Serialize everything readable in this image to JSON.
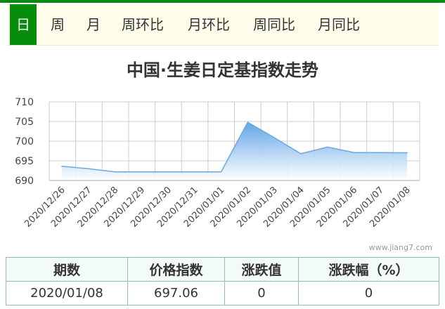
{
  "tabs": [
    "日",
    "周",
    "月",
    "周环比",
    "月环比",
    "周同比",
    "月同比"
  ],
  "active_tab": 0,
  "chart_title": "中国·生姜日定基指数走势",
  "watermark": "www.jiang7.com",
  "colors": {
    "brand": "#078d0c",
    "line": "#6aa9e0",
    "grid": "#cccccc"
  },
  "chart_data": {
    "type": "area",
    "title": "中国·生姜日定基指数走势",
    "x": [
      "2020/12/26",
      "2020/12/27",
      "2020/12/28",
      "2020/12/29",
      "2020/12/30",
      "2020/12/31",
      "2020/01/01",
      "2020/01/02",
      "2020/01/03",
      "2020/01/04",
      "2020/01/05",
      "2020/01/06",
      "2020/01/07",
      "2020/01/08"
    ],
    "values": [
      693.6,
      693.0,
      692.2,
      692.2,
      692.2,
      692.2,
      692.2,
      704.8,
      700.9,
      696.8,
      698.5,
      697.1,
      697.1,
      697.06
    ],
    "ylim": [
      690,
      710
    ],
    "yticks": [
      690,
      695,
      700,
      705,
      710
    ],
    "grid": true,
    "legend": "none"
  },
  "table": {
    "headers": [
      "期数",
      "价格指数",
      "涨跌值",
      "涨跌幅（%）"
    ],
    "row": [
      "2020/01/08",
      "697.06",
      "0",
      "0"
    ]
  }
}
